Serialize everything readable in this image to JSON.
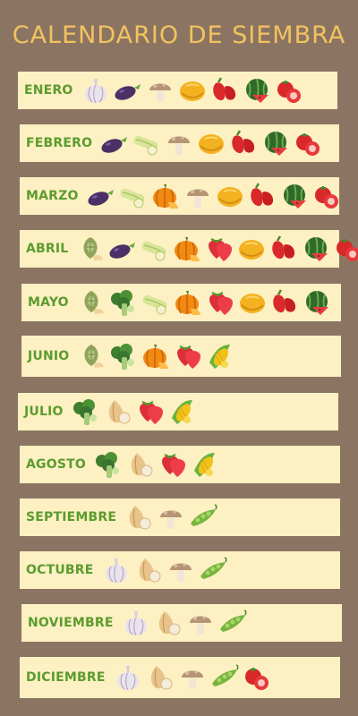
{
  "title": "CALENDARIO DE SIEMBRA",
  "months": [
    {
      "label": "ENERO",
      "icons": [
        "garlic-icon",
        "eggplant-icon",
        "mushroom-icon",
        "melon-icon",
        "pepper-icon",
        "watermelon-icon",
        "tomato-icon"
      ]
    },
    {
      "label": "FEBRERO",
      "icons": [
        "eggplant-icon",
        "zucchini-icon",
        "mushroom-icon",
        "melon-icon",
        "pepper-icon",
        "watermelon-icon",
        "tomato-icon"
      ]
    },
    {
      "label": "MARZO",
      "icons": [
        "eggplant-icon",
        "zucchini-icon",
        "pumpkin-icon",
        "mushroom-icon",
        "melon-icon",
        "pepper-icon",
        "watermelon-icon",
        "tomato-icon"
      ]
    },
    {
      "label": "ABRIL",
      "icons": [
        "artichoke-icon",
        "eggplant-icon",
        "zucchini-icon",
        "pumpkin-icon",
        "strawberry-icon",
        "melon-icon",
        "pepper-icon",
        "watermelon-icon",
        "tomato-icon"
      ]
    },
    {
      "label": "MAYO",
      "icons": [
        "artichoke-icon",
        "broccoli-icon",
        "zucchini-icon",
        "pumpkin-icon",
        "strawberry-icon",
        "melon-icon",
        "pepper-icon",
        "watermelon-icon"
      ]
    },
    {
      "label": "JUNIO",
      "icons": [
        "artichoke-icon",
        "broccoli-icon",
        "pumpkin-icon",
        "strawberry-icon",
        "corn-icon"
      ]
    },
    {
      "label": "JULIO",
      "icons": [
        "broccoli-icon",
        "onion-icon",
        "strawberry-icon",
        "corn-icon"
      ]
    },
    {
      "label": "AGOSTO",
      "icons": [
        "broccoli-icon",
        "onion-icon",
        "strawberry-icon",
        "corn-icon"
      ]
    },
    {
      "label": "SEPTIEMBRE",
      "icons": [
        "onion-icon",
        "mushroom-icon",
        "peas-icon"
      ]
    },
    {
      "label": "OCTUBRE",
      "icons": [
        "garlic-icon",
        "onion-icon",
        "mushroom-icon",
        "peas-icon"
      ]
    },
    {
      "label": "NOVIEMBRE",
      "icons": [
        "garlic-icon",
        "onion-icon",
        "mushroom-icon",
        "peas-icon"
      ]
    },
    {
      "label": "DICIEMBRE",
      "icons": [
        "garlic-icon",
        "onion-icon",
        "mushroom-icon",
        "peas-icon",
        "tomato-icon"
      ]
    }
  ],
  "colors": {
    "background": "#8b7562",
    "row": "#fdf0c3",
    "month_text": "#5b9c2e",
    "title": "#f3c25f"
  }
}
